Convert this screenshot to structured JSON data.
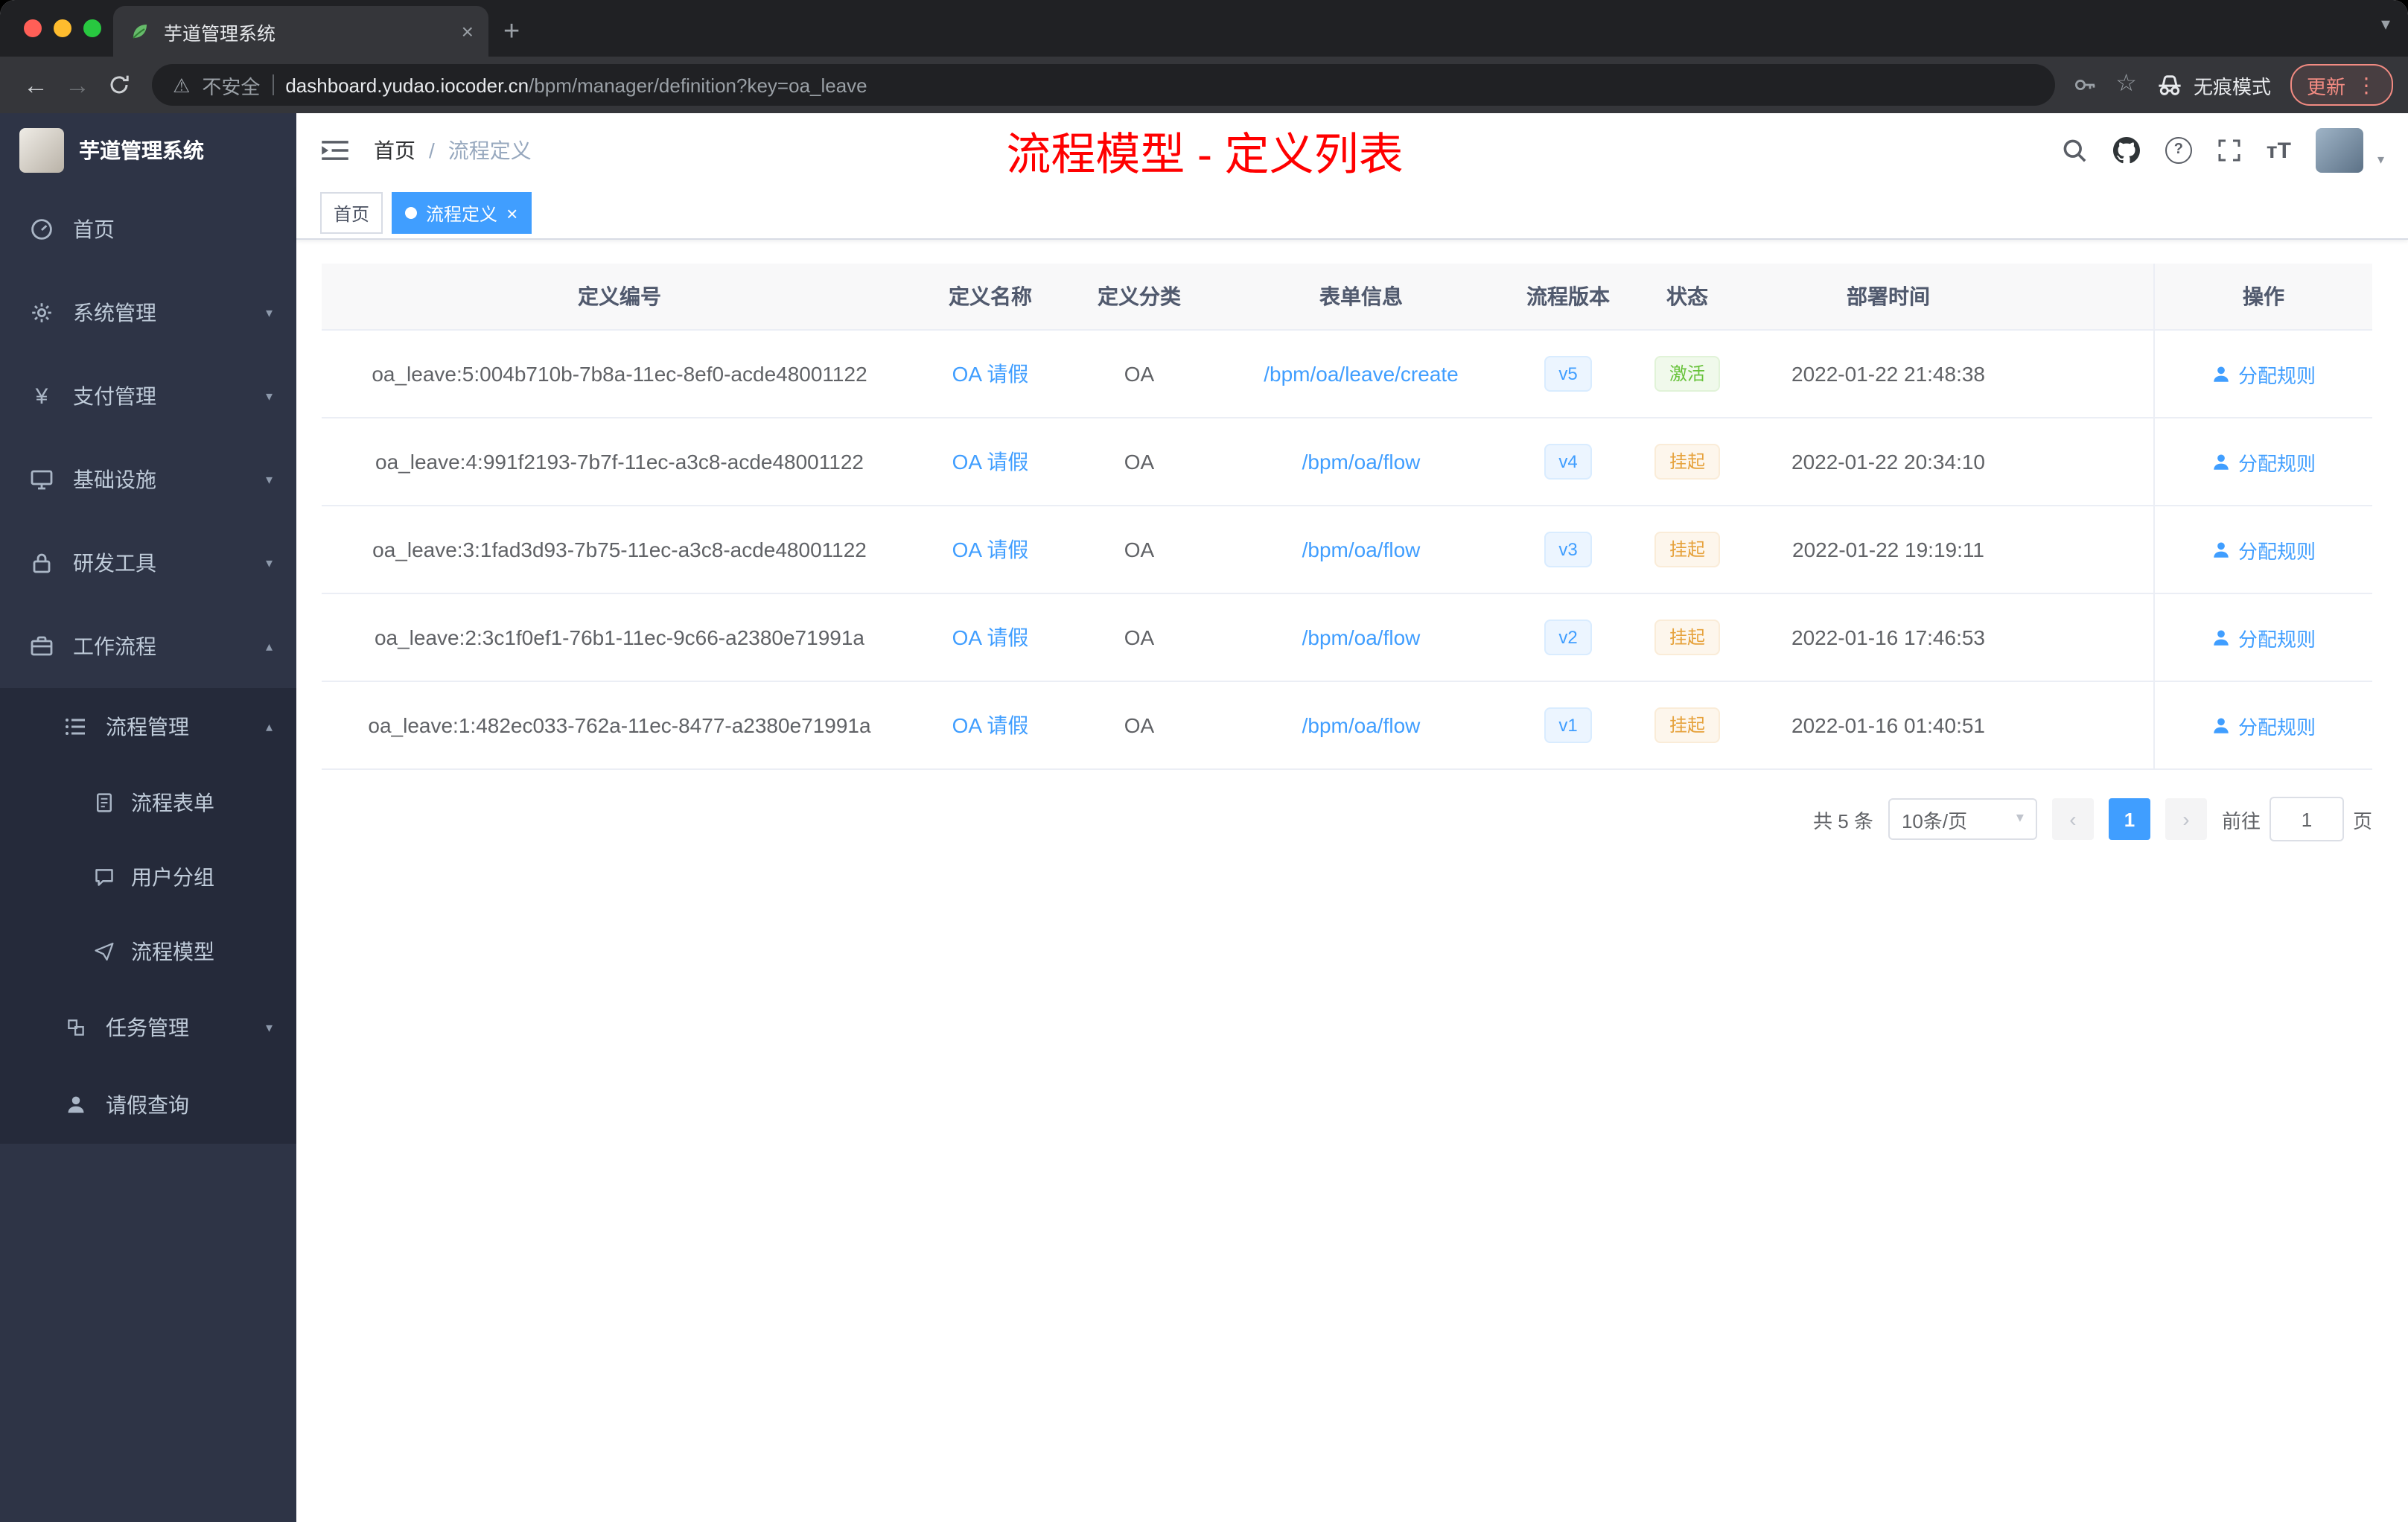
{
  "browser": {
    "tab_title": "芋道管理系统",
    "security_label": "不安全",
    "url_host": "dashboard.yudao.iocoder.cn",
    "url_path": "/bpm/manager/definition?key=oa_leave",
    "incognito_label": "无痕模式",
    "update_label": "更新"
  },
  "sidebar": {
    "logo_title": "芋道管理系统",
    "home": "首页",
    "system": "系统管理",
    "payment": "支付管理",
    "infra": "基础设施",
    "devtools": "研发工具",
    "workflow": "工作流程",
    "process_mgmt": "流程管理",
    "process_form": "流程表单",
    "user_group": "用户分组",
    "process_model": "流程模型",
    "task_mgmt": "任务管理",
    "leave_query": "请假查询"
  },
  "header": {
    "breadcrumb_home": "首页",
    "breadcrumb_current": "流程定义",
    "page_title": "流程模型 - 定义列表"
  },
  "tags": {
    "home": "首页",
    "active": "流程定义"
  },
  "table": {
    "columns": {
      "id": "定义编号",
      "name": "定义名称",
      "category": "定义分类",
      "form": "表单信息",
      "version": "流程版本",
      "status": "状态",
      "deploy_time": "部署时间",
      "actions": "操作"
    },
    "rows": [
      {
        "id": "oa_leave:5:004b710b-7b8a-11ec-8ef0-acde48001122",
        "name": "OA 请假",
        "category": "OA",
        "form": "/bpm/oa/leave/create",
        "version": "v5",
        "status": "激活",
        "status_type": "success",
        "deploy_time": "2022-01-22 21:48:38",
        "action": "分配规则"
      },
      {
        "id": "oa_leave:4:991f2193-7b7f-11ec-a3c8-acde48001122",
        "name": "OA 请假",
        "category": "OA",
        "form": "/bpm/oa/flow",
        "version": "v4",
        "status": "挂起",
        "status_type": "warning",
        "deploy_time": "2022-01-22 20:34:10",
        "action": "分配规则"
      },
      {
        "id": "oa_leave:3:1fad3d93-7b75-11ec-a3c8-acde48001122",
        "name": "OA 请假",
        "category": "OA",
        "form": "/bpm/oa/flow",
        "version": "v3",
        "status": "挂起",
        "status_type": "warning",
        "deploy_time": "2022-01-22 19:19:11",
        "action": "分配规则"
      },
      {
        "id": "oa_leave:2:3c1f0ef1-76b1-11ec-9c66-a2380e71991a",
        "name": "OA 请假",
        "category": "OA",
        "form": "/bpm/oa/flow",
        "version": "v2",
        "status": "挂起",
        "status_type": "warning",
        "deploy_time": "2022-01-16 17:46:53",
        "action": "分配规则"
      },
      {
        "id": "oa_leave:1:482ec033-762a-11ec-8477-a2380e71991a",
        "name": "OA 请假",
        "category": "OA",
        "form": "/bpm/oa/flow",
        "version": "v1",
        "status": "挂起",
        "status_type": "warning",
        "deploy_time": "2022-01-16 01:40:51",
        "action": "分配规则"
      }
    ]
  },
  "pagination": {
    "total": "共 5 条",
    "page_size": "10条/页",
    "current_page": "1",
    "goto_label": "前往",
    "goto_value": "1",
    "page_unit": "页"
  },
  "colors": {
    "primary": "#409eff",
    "title_red": "#ff0000",
    "success_text": "#67c23a",
    "warning_text": "#e6a23c",
    "sidebar_bg": "#2e3446",
    "submenu_bg": "#252a3a"
  }
}
